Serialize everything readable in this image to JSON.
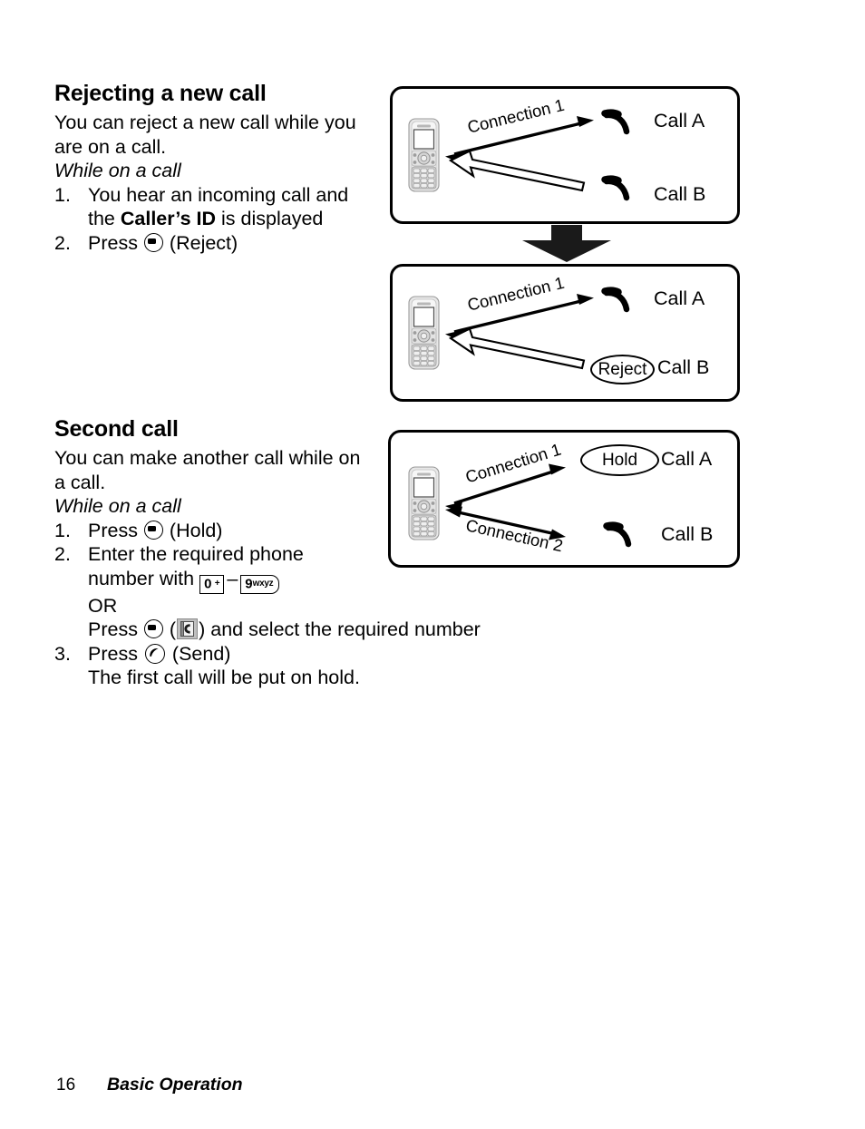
{
  "sections": [
    {
      "id": "rejecting-a-new-call",
      "heading": "Rejecting a new call",
      "intro": "You can reject a new call while you are on a call.",
      "condition": "While on a call",
      "steps": [
        {
          "num": "1.",
          "line1_pre": "You hear an incoming call and",
          "line2_pre": "the ",
          "line2_bold": "Caller’s ID",
          "line2_post": " is displayed"
        },
        {
          "num": "2.",
          "pre": "Press ",
          "key": "soft-key-icon",
          "post": "(Reject)"
        }
      ]
    },
    {
      "id": "second-call",
      "heading": "Second call",
      "intro": "You can make another call while on a call.",
      "condition": "While on a call",
      "steps": [
        {
          "num": "1.",
          "pre": "Press ",
          "key": "soft-key-icon",
          "post": "(Hold)"
        },
        {
          "num": "2.",
          "line1": "Enter the required phone",
          "line2_pre": "number with ",
          "key_from_digit": "0",
          "key_from_sup": "+",
          "key_range_dash": "–",
          "key_to_digit": "9",
          "key_to_sup": "wxyz",
          "or": "OR",
          "line4_pre": "Press ",
          "line4_key": "soft-key-icon",
          "line4_mid_open": "(",
          "line4_icon": "phonebook-icon",
          "line4_mid_close": ")",
          "line4_post": " and select the required number"
        },
        {
          "num": "3.",
          "pre": "Press ",
          "key": "send-key-icon",
          "post": "(Send)",
          "note": "The first call will be put on hold."
        }
      ]
    }
  ],
  "diagrams": [
    {
      "id": "diagram-1",
      "phone": "mobile-phone-illustration",
      "connection_labels": [
        "Connection 1"
      ],
      "call_a_label": "Call A",
      "call_b_label": "Call B",
      "call_a_icon": "incoming-call-arc-icon",
      "call_b_icon": "incoming-call-arc-icon",
      "badge": null
    },
    {
      "id": "diagram-2",
      "phone": "mobile-phone-illustration",
      "connection_labels": [
        "Connection 1"
      ],
      "call_a_label": "Call A",
      "call_b_label": "Call B",
      "call_a_icon": "incoming-call-arc-icon",
      "call_b_icon": null,
      "badge": "Reject"
    },
    {
      "id": "diagram-3",
      "phone": "mobile-phone-illustration",
      "connection_labels": [
        "Connection 1",
        "Connection 2"
      ],
      "call_a_label": "Call A",
      "call_b_label": "Call B",
      "call_a_icon": null,
      "call_b_icon": "incoming-call-arc-icon",
      "badge": "Hold"
    }
  ],
  "flow_arrow": "down-arrow-icon",
  "footer": {
    "page_number": "16",
    "section_name": "Basic Operation"
  },
  "colors": {
    "ink": "#000000",
    "page": "#ffffff",
    "icon_grey": "#bfbfbf",
    "phone_body": "#d9d9d9"
  }
}
